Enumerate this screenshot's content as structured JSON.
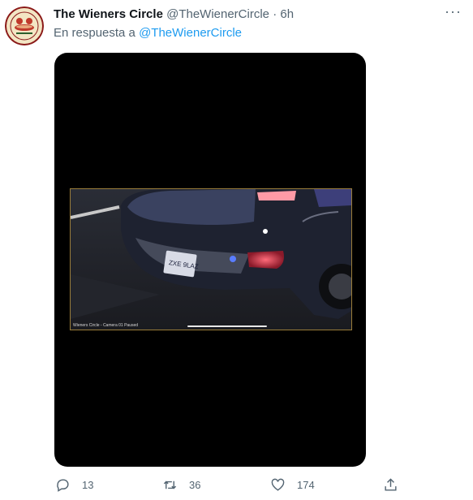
{
  "tweet": {
    "author_name": "The Wieners Circle",
    "author_handle": "@TheWienerCircle",
    "separator": "·",
    "time": "6h",
    "reply_prefix": "En respuesta a",
    "reply_handle": "@TheWienerCircle",
    "more_label": "···"
  },
  "media": {
    "overlay_text": "Wieners Circle - Camera 01 Paused",
    "plate_text": "ZXE 9LAZ"
  },
  "actions": {
    "reply_count": "13",
    "retweet_count": "36",
    "like_count": "174"
  },
  "icons": [
    "avatar-logo",
    "more-icon",
    "reply-icon",
    "retweet-icon",
    "like-icon",
    "share-icon"
  ],
  "colors": {
    "link": "#1d9bf0",
    "secondary": "#536471",
    "primary": "#0f1419"
  }
}
